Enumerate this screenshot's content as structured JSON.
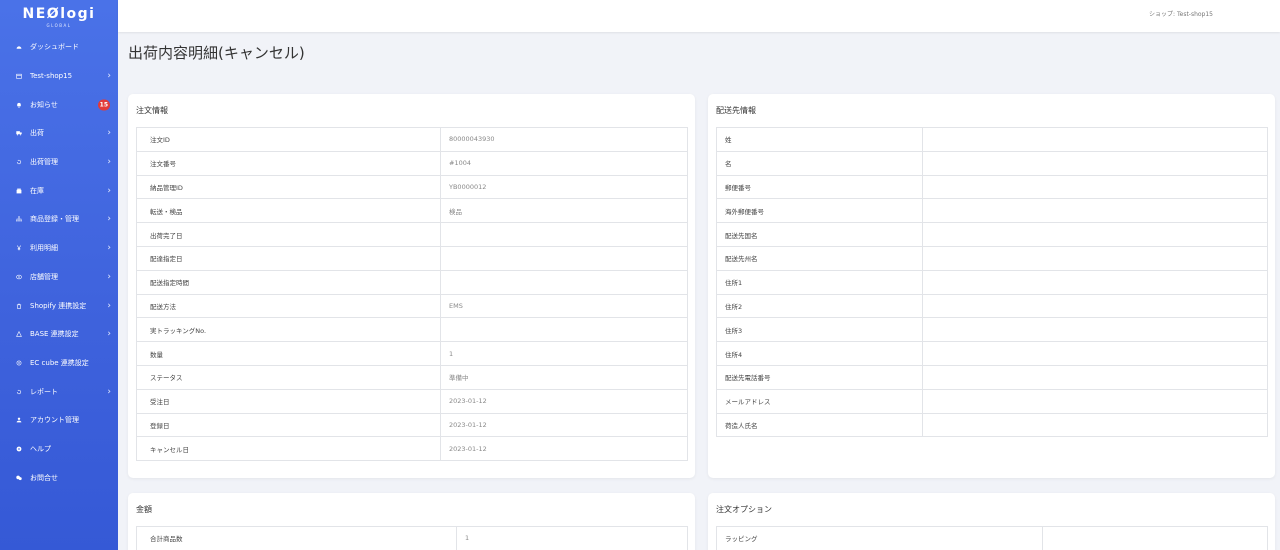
{
  "brand": {
    "name": "NEØlogi",
    "sub": "GLOBAL"
  },
  "topbar": {
    "shop_label": "ショップ: Test-shop15"
  },
  "page": {
    "title": "出荷内容明細(キャンセル)"
  },
  "sidebar": {
    "items": [
      {
        "label": "ダッシュボード",
        "icon": "dashboard-icon",
        "chevron": false
      },
      {
        "label": "Test-shop15",
        "icon": "calendar-icon",
        "chevron": true
      },
      {
        "label": "お知らせ",
        "icon": "bell-icon",
        "chevron": false,
        "badge": "15"
      },
      {
        "label": "出荷",
        "icon": "truck-icon",
        "chevron": true
      },
      {
        "label": "出荷管理",
        "icon": "history-icon",
        "chevron": true
      },
      {
        "label": "在庫",
        "icon": "box-icon",
        "chevron": true
      },
      {
        "label": "商品登録・管理",
        "icon": "sitemap-icon",
        "chevron": true
      },
      {
        "label": "利用明細",
        "icon": "yen-icon",
        "chevron": true
      },
      {
        "label": "店舗管理",
        "icon": "store-icon",
        "chevron": true
      },
      {
        "label": "Shopify 連携設定",
        "icon": "shopify-icon",
        "chevron": true
      },
      {
        "label": "BASE 連携設定",
        "icon": "base-icon",
        "chevron": true
      },
      {
        "label": "EC cube 連携設定",
        "icon": "cube-icon",
        "chevron": false
      },
      {
        "label": "レポート",
        "icon": "report-icon",
        "chevron": true
      },
      {
        "label": "アカウント管理",
        "icon": "user-icon",
        "chevron": false
      },
      {
        "label": "ヘルプ",
        "icon": "help-icon",
        "chevron": false
      },
      {
        "label": "お問合せ",
        "icon": "chat-icon",
        "chevron": false
      }
    ]
  },
  "order_info": {
    "title": "注文情報",
    "rows": [
      {
        "label": "注文ID",
        "value": "80000043930"
      },
      {
        "label": "注文番号",
        "value": "#1004"
      },
      {
        "label": "納品管理ID",
        "value": "YB0000012"
      },
      {
        "label": "転送・検品",
        "value": "検品"
      },
      {
        "label": "出荷完了日",
        "value": ""
      },
      {
        "label": "配達指定日",
        "value": ""
      },
      {
        "label": "配送指定時間",
        "value": ""
      },
      {
        "label": "配送方法",
        "value": "EMS"
      },
      {
        "label": "実トラッキングNo.",
        "value": ""
      },
      {
        "label": "数量",
        "value": "1"
      },
      {
        "label": "ステータス",
        "value": "準備中"
      },
      {
        "label": "受注日",
        "value": "2023-01-12"
      },
      {
        "label": "登録日",
        "value": "2023-01-12"
      },
      {
        "label": "キャンセル日",
        "value": "2023-01-12"
      }
    ]
  },
  "shipping_info": {
    "title": "配送先情報",
    "rows": [
      {
        "label": "姓",
        "value": ""
      },
      {
        "label": "名",
        "value": ""
      },
      {
        "label": "郵便番号",
        "value": ""
      },
      {
        "label": "海外郵便番号",
        "value": ""
      },
      {
        "label": "配送先国名",
        "value": ""
      },
      {
        "label": "配送先州名",
        "value": ""
      },
      {
        "label": "住所1",
        "value": ""
      },
      {
        "label": "住所2",
        "value": ""
      },
      {
        "label": "住所3",
        "value": ""
      },
      {
        "label": "住所4",
        "value": ""
      },
      {
        "label": "配送先電話番号",
        "value": ""
      },
      {
        "label": "メールアドレス",
        "value": ""
      },
      {
        "label": "荷造人氏名",
        "value": ""
      }
    ]
  },
  "amount": {
    "title": "金額",
    "rows": [
      {
        "label": "合計商品数",
        "value": "1"
      }
    ]
  },
  "order_options": {
    "title": "注文オプション",
    "rows": [
      {
        "label": "ラッピング",
        "value": ""
      }
    ]
  }
}
